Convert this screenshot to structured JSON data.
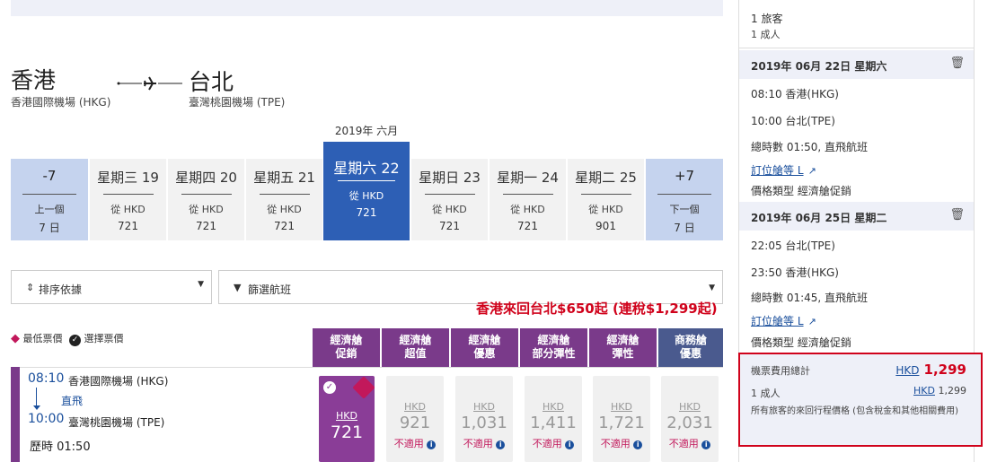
{
  "route": {
    "origin_city": "香港",
    "origin_airport": "香港國際機場 (HKG)",
    "dest_city": "台北",
    "dest_airport": "臺灣桃園機場 (TPE)"
  },
  "month_label": "2019年 六月",
  "date_strip": {
    "prev": {
      "day": "-7",
      "line1": "上一個",
      "line2": "7 日"
    },
    "next": {
      "day": "+7",
      "line1": "下一個",
      "line2": "7 日"
    },
    "days": [
      {
        "label": "星期三 19",
        "from": "從 HKD",
        "price": "721"
      },
      {
        "label": "星期四 20",
        "from": "從 HKD",
        "price": "721"
      },
      {
        "label": "星期五 21",
        "from": "從 HKD",
        "price": "721"
      },
      {
        "label": "星期六 22",
        "from": "從 HKD",
        "price": "721"
      },
      {
        "label": "星期日 23",
        "from": "從 HKD",
        "price": "721"
      },
      {
        "label": "星期一 24",
        "from": "從 HKD",
        "price": "721"
      },
      {
        "label": "星期二 25",
        "from": "從 HKD",
        "price": "901"
      }
    ]
  },
  "sort_label": "排序依據",
  "filter_label": "篩選航班",
  "promo_text": "香港來回台北$650起 (連稅$1,299起)",
  "legend": {
    "lowest": "最低票價",
    "selected": "選擇票價"
  },
  "fare_headers": [
    {
      "line1": "經濟艙",
      "line2": "促銷"
    },
    {
      "line1": "經濟艙",
      "line2": "超值"
    },
    {
      "line1": "經濟艙",
      "line2": "優惠"
    },
    {
      "line1": "經濟艙",
      "line2": "部分彈性"
    },
    {
      "line1": "經濟艙",
      "line2": "彈性"
    },
    {
      "line1": "商務艙",
      "line2": "優惠"
    }
  ],
  "flight": {
    "dep_time": "08:10",
    "dep_airport": "香港國際機場 (HKG)",
    "direct": "直飛",
    "arr_time": "10:00",
    "arr_airport": "臺灣桃園機場 (TPE)",
    "duration": "歷時 01:50"
  },
  "fares": [
    {
      "cur": "HKD",
      "amt": "721",
      "na": ""
    },
    {
      "cur": "HKD",
      "amt": "921",
      "na": "不適用"
    },
    {
      "cur": "HKD",
      "amt": "1,031",
      "na": "不適用"
    },
    {
      "cur": "HKD",
      "amt": "1,411",
      "na": "不適用"
    },
    {
      "cur": "HKD",
      "amt": "1,721",
      "na": "不適用"
    },
    {
      "cur": "HKD",
      "amt": "2,031",
      "na": "不適用"
    }
  ],
  "summary": {
    "pax_line1": "1 旅客",
    "pax_line2": "1 成人",
    "outbound": {
      "date": "2019年 06月 22日 星期六",
      "dep": "08:10 香港(HKG)",
      "arr": "10:00 台北(TPE)",
      "info": "總時數 01:50, 直飛航班",
      "class_link": "訂位艙等 L",
      "fare_type": "價格類型 經濟艙促銷"
    },
    "inbound": {
      "date": "2019年 06月 25日 星期二",
      "dep": "22:05 台北(TPE)",
      "arr": "23:50 香港(HKG)",
      "info": "總時數 01:45, 直飛航班",
      "class_link": "訂位艙等 L",
      "fare_type": "價格類型 經濟艙促銷"
    },
    "total": {
      "label": "機票費用總計",
      "cur": "HKD",
      "amount": "1,299",
      "adult_label": "1 成人",
      "adult_cur": "HKD",
      "adult_amount": "1,299",
      "note": "所有旅客的來回行程價格 (包含稅金和其他相關費用)"
    }
  },
  "colors": {
    "selected_date": "#2d5fb5",
    "fare_header": "#7a3a8a",
    "business_header": "#4a5a8e",
    "promo_red": "#d0021b"
  }
}
